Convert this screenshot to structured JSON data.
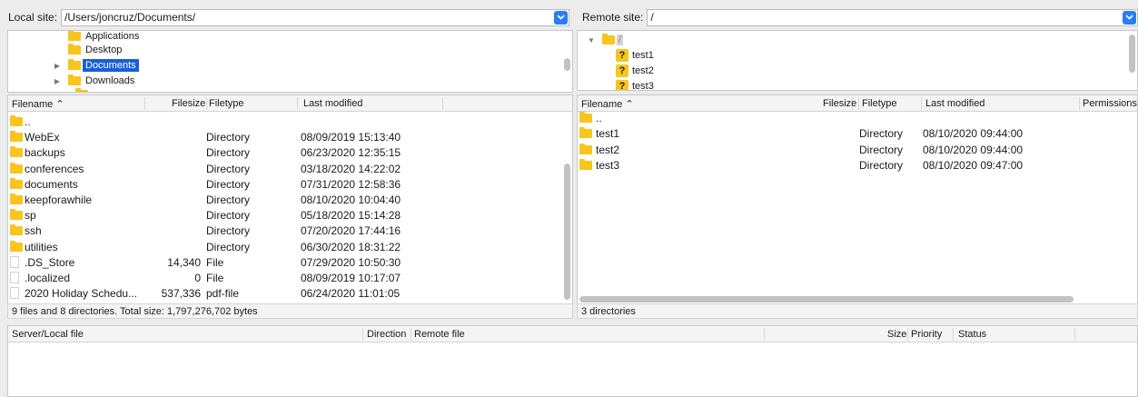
{
  "local": {
    "label": "Local site:",
    "path": "/Users/joncruz/Documents/",
    "tree": [
      {
        "name": "Applications",
        "expandable": false,
        "selected": false
      },
      {
        "name": "Desktop",
        "expandable": false,
        "selected": false
      },
      {
        "name": "Documents",
        "expandable": true,
        "selected": true
      },
      {
        "name": "Downloads",
        "expandable": true,
        "selected": false
      }
    ],
    "columns": {
      "filename": "Filename",
      "filesize": "Filesize",
      "filetype": "Filetype",
      "modified": "Last modified"
    },
    "files": [
      {
        "name": "..",
        "size": "",
        "type": "",
        "modified": "",
        "kind": "folder"
      },
      {
        "name": "WebEx",
        "size": "",
        "type": "Directory",
        "modified": "08/09/2019 15:13:40",
        "kind": "folder"
      },
      {
        "name": "backups",
        "size": "",
        "type": "Directory",
        "modified": "06/23/2020 12:35:15",
        "kind": "folder"
      },
      {
        "name": "conferences",
        "size": "",
        "type": "Directory",
        "modified": "03/18/2020 14:22:02",
        "kind": "folder"
      },
      {
        "name": "documents",
        "size": "",
        "type": "Directory",
        "modified": "07/31/2020 12:58:36",
        "kind": "folder"
      },
      {
        "name": "keepforawhile",
        "size": "",
        "type": "Directory",
        "modified": "08/10/2020 10:04:40",
        "kind": "folder"
      },
      {
        "name": "sp",
        "size": "",
        "type": "Directory",
        "modified": "05/18/2020 15:14:28",
        "kind": "folder"
      },
      {
        "name": "ssh",
        "size": "",
        "type": "Directory",
        "modified": "07/20/2020 17:44:16",
        "kind": "folder"
      },
      {
        "name": "utilities",
        "size": "",
        "type": "Directory",
        "modified": "06/30/2020 18:31:22",
        "kind": "folder"
      },
      {
        "name": ".DS_Store",
        "size": "14,340",
        "type": "File",
        "modified": "07/29/2020 10:50:30",
        "kind": "file"
      },
      {
        "name": ".localized",
        "size": "0",
        "type": "File",
        "modified": "08/09/2019 10:17:07",
        "kind": "file"
      },
      {
        "name": "2020 Holiday Schedu...",
        "size": "537,336",
        "type": "pdf-file",
        "modified": "06/24/2020 11:01:05",
        "kind": "file"
      }
    ],
    "status": "9 files and 8 directories. Total size: 1,797,276,702 bytes"
  },
  "remote": {
    "label": "Remote site:",
    "path": "/",
    "tree_root": "/",
    "tree": [
      {
        "name": "test1"
      },
      {
        "name": "test2"
      },
      {
        "name": "test3"
      }
    ],
    "columns": {
      "filename": "Filename",
      "filesize": "Filesize",
      "filetype": "Filetype",
      "modified": "Last modified",
      "permissions": "Permissions"
    },
    "files": [
      {
        "name": "..",
        "type": "",
        "modified": ""
      },
      {
        "name": "test1",
        "type": "Directory",
        "modified": "08/10/2020 09:44:00"
      },
      {
        "name": "test2",
        "type": "Directory",
        "modified": "08/10/2020 09:44:00"
      },
      {
        "name": "test3",
        "type": "Directory",
        "modified": "08/10/2020 09:47:00"
      }
    ],
    "status": "3 directories"
  },
  "queue": {
    "columns": {
      "server_local": "Server/Local file",
      "direction": "Direction",
      "remote": "Remote file",
      "size": "Size",
      "priority": "Priority",
      "status": "Status"
    }
  },
  "colors": {
    "accent": "#1a5fd6",
    "folder": "#f7c51e",
    "dropdown": "#2b7df0"
  }
}
